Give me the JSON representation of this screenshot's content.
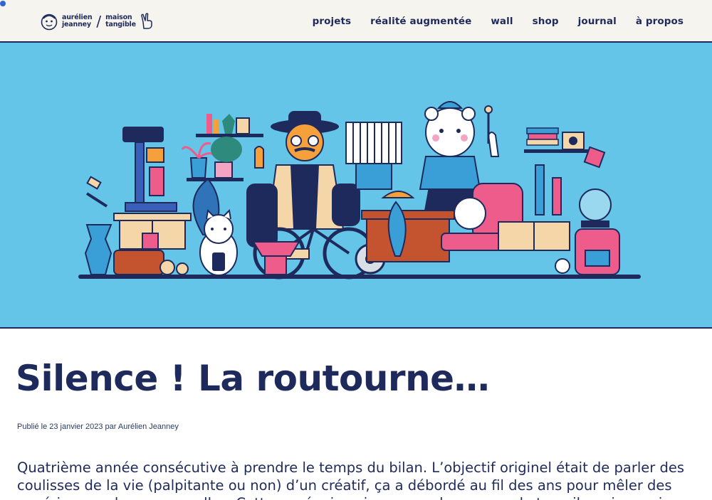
{
  "header": {
    "brand": {
      "name_line1": "aurélien",
      "name_line2": "jeanney",
      "separator": "/",
      "studio_line1": "maison",
      "studio_line2": "tangible"
    },
    "nav": [
      "projets",
      "réalité augmentée",
      "wall",
      "shop",
      "journal",
      "à propos"
    ]
  },
  "hero": {
    "illustration": "workshop-illustration",
    "background": "#64c5e8"
  },
  "article": {
    "title": "Silence ! La routourne…",
    "meta": "Publié le 23 janvier 2023 par Aurélien Jeanney",
    "intro": "Quatrième année consécutive à prendre le temps du bilan. L’objectif originel était de parler des coulisses de la vie (palpitante ou non) d’un créatif, ça a débordé au fil des ans pour mêler des expériences plus personnelles. Cette année, je vais vous parler un peu de travail, mais aussi un"
  },
  "colors": {
    "ink": "#1f2a5c",
    "header_bg": "#f5f4ee",
    "pink": "#ee5c8c",
    "orange": "#f5a03a"
  }
}
